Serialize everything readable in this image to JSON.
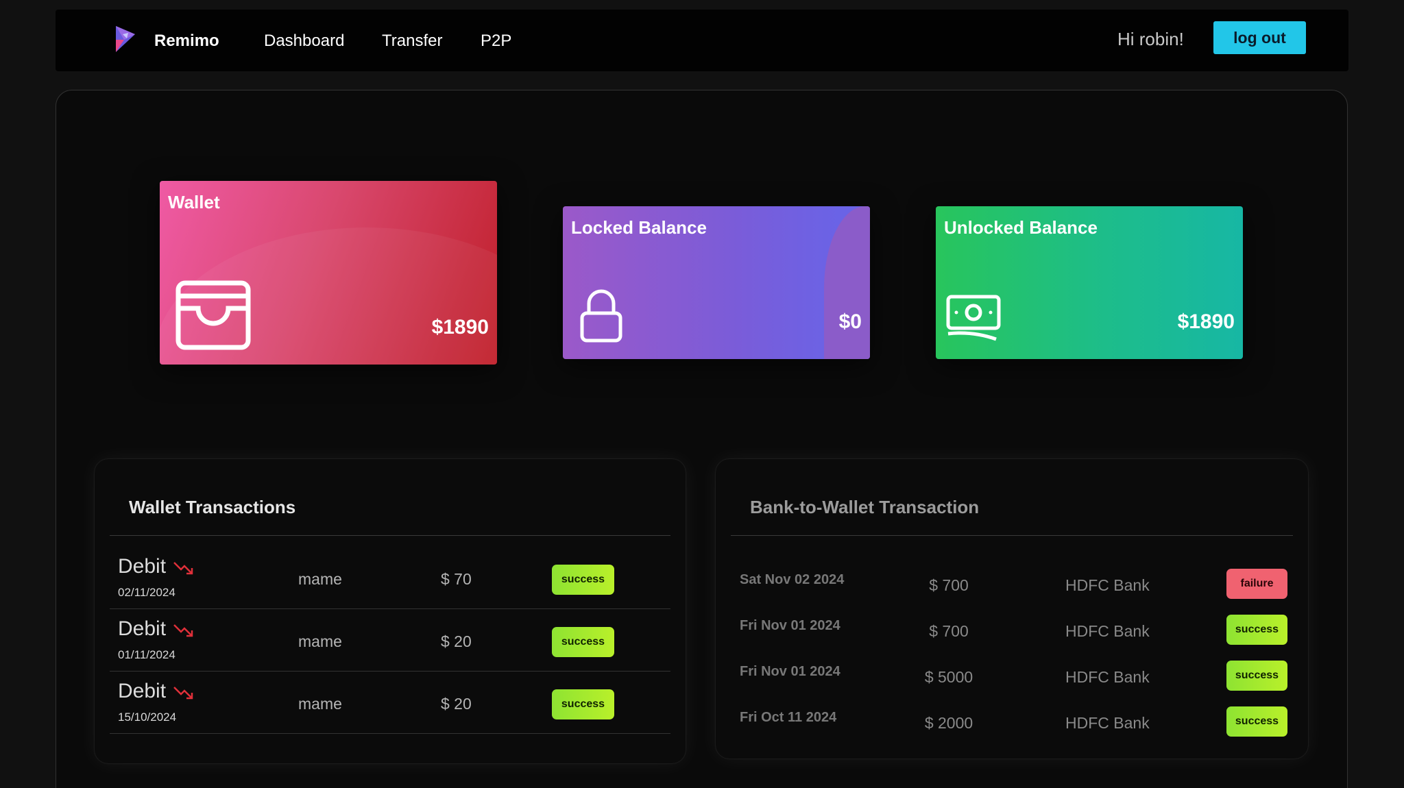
{
  "nav": {
    "brand": "Remimo",
    "links": [
      "Dashboard",
      "Transfer",
      "P2P"
    ],
    "greeting": "Hi robin!",
    "logout_label": "log out"
  },
  "cards": {
    "wallet": {
      "title": "Wallet",
      "amount": "$1890"
    },
    "locked": {
      "title": "Locked Balance",
      "amount": "$0"
    },
    "unlocked": {
      "title": "Unlocked Balance",
      "amount": "$1890"
    }
  },
  "wallet_transactions": {
    "heading": "Wallet Transactions",
    "rows": [
      {
        "type": "Debit",
        "date": "02/11/2024",
        "name": "mame",
        "amount": "$ 70",
        "status": "success"
      },
      {
        "type": "Debit",
        "date": "01/11/2024",
        "name": "mame",
        "amount": "$ 20",
        "status": "success"
      },
      {
        "type": "Debit",
        "date": "15/10/2024",
        "name": "mame",
        "amount": "$ 20",
        "status": "success"
      }
    ]
  },
  "bank_transactions": {
    "heading": "Bank-to-Wallet Transaction",
    "rows": [
      {
        "date": "Sat Nov 02 2024",
        "amount": "$ 700",
        "bank": "HDFC Bank",
        "status": "failure"
      },
      {
        "date": "Fri Nov 01 2024",
        "amount": "$ 700",
        "bank": "HDFC Bank",
        "status": "success"
      },
      {
        "date": "Fri Nov 01 2024",
        "amount": "$ 5000",
        "bank": "HDFC Bank",
        "status": "success"
      },
      {
        "date": "Fri Oct 11 2024",
        "amount": "$ 2000",
        "bank": "HDFC Bank",
        "status": "success"
      }
    ]
  },
  "icons": {
    "logo": "remimo-logo-icon",
    "wallet": "wallet-icon",
    "locked": "lock-icon",
    "unlocked": "cash-icon",
    "debit": "trending-down-icon"
  },
  "colors": {
    "accent": "#22c6e8",
    "success": "#a6e92e",
    "failure": "#f06270",
    "debit_arrow": "#e0303a"
  }
}
